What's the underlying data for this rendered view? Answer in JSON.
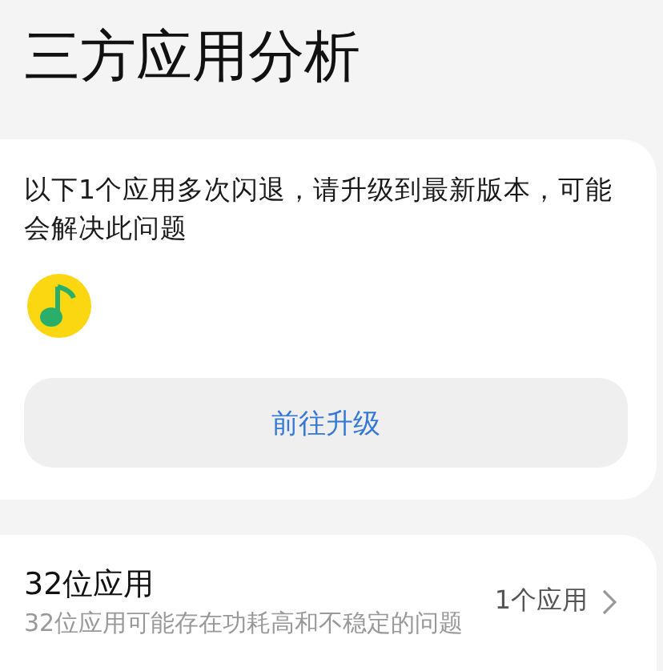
{
  "title": "三方应用分析",
  "crash_card": {
    "message": "以下1个应用多次闪退，请升级到最新版本，可能会解决此问题",
    "apps": [
      {
        "kind": "music"
      }
    ],
    "button": "前往升级"
  },
  "bit32_card": {
    "title": "32位应用",
    "subtitle": "32位应用可能存在功耗高和不稳定的问题",
    "count": "1个应用"
  }
}
